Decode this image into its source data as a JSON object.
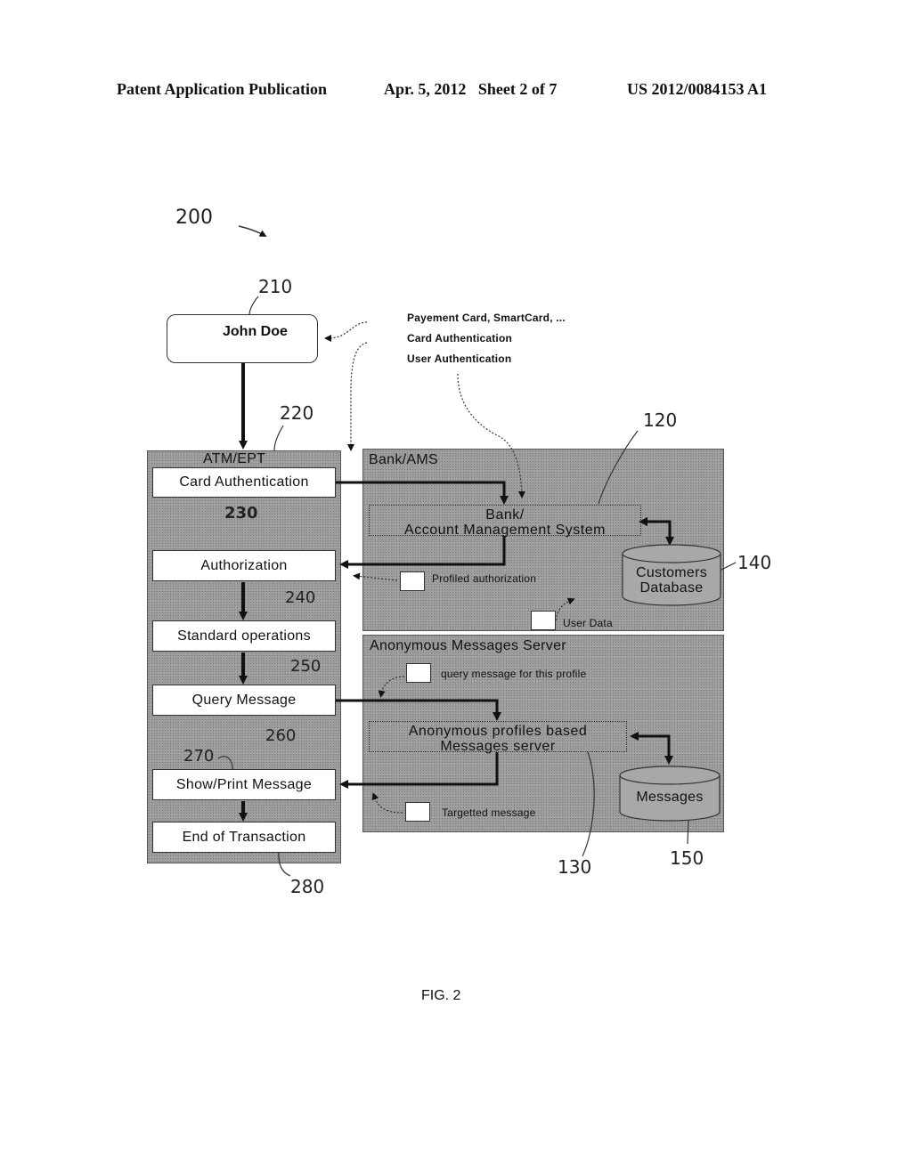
{
  "header": {
    "publication": "Patent Application Publication",
    "date_sheet": "Apr. 5, 2012   Sheet 2 of 7",
    "number": "US 2012/0084153 A1"
  },
  "figure": {
    "ref_main": "200",
    "caption": "FIG. 2"
  },
  "user": {
    "label": "John Doe",
    "ref": "210"
  },
  "card_info": {
    "lines": [
      "Payement Card, SmartCard, ...",
      "Card Authentication",
      "User Authentication"
    ]
  },
  "atm": {
    "title": "ATM/EPT",
    "ref": "220",
    "steps": [
      {
        "label": "Card Authentication",
        "ref": "230"
      },
      {
        "label": "Authorization",
        "ref": "240"
      },
      {
        "label": "Standard operations",
        "ref": "250"
      },
      {
        "label": "Query Message",
        "ref": "260"
      },
      {
        "label": "Show/Print Message",
        "ref": "270"
      },
      {
        "label": "End of Transaction",
        "ref": "280"
      }
    ]
  },
  "bank": {
    "title": "Bank/AMS",
    "system_line1": "Bank/",
    "system_line2": "Account Management System",
    "system_ref": "120",
    "db_line1": "Customers",
    "db_line2": "Database",
    "db_ref": "140",
    "profiled_auth": "Profiled authorization",
    "user_data": "User Data"
  },
  "messages_server": {
    "title": "Anonymous Messages Server",
    "query_label": "query message for this profile",
    "server_line1": "Anonymous profiles based",
    "server_line2": "Messages server",
    "server_ref": "130",
    "db_label": "Messages",
    "db_ref": "150",
    "targeted_label": "Targetted message"
  }
}
